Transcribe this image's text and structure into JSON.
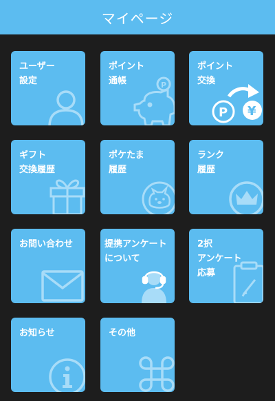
{
  "header": {
    "title": "マイページ"
  },
  "accent_color": "#5cbcf0",
  "tiles": [
    {
      "label": "ユーザー\n設定",
      "icon": "user-icon"
    },
    {
      "label": "ポイント\n通帳",
      "icon": "piggy-bank-icon"
    },
    {
      "label": "ポイント\n交換",
      "icon": "point-to-yen-exchange-icon"
    },
    {
      "label": "ギフト\n交換履歴",
      "icon": "gift-icon"
    },
    {
      "label": "ポケたま\n履歴",
      "icon": "pokétama-character-icon"
    },
    {
      "label": "ランク\n履歴",
      "icon": "crown-icon"
    },
    {
      "label": "お問い合わせ",
      "icon": "envelope-icon"
    },
    {
      "label": "提携アンケート\nについて",
      "icon": "operator-headset-icon"
    },
    {
      "label": "2択\nアンケート\n応募",
      "icon": "clipboard-pen-icon"
    },
    {
      "label": "お知らせ",
      "icon": "info-icon"
    },
    {
      "label": "その他",
      "icon": "command-key-icon"
    }
  ]
}
